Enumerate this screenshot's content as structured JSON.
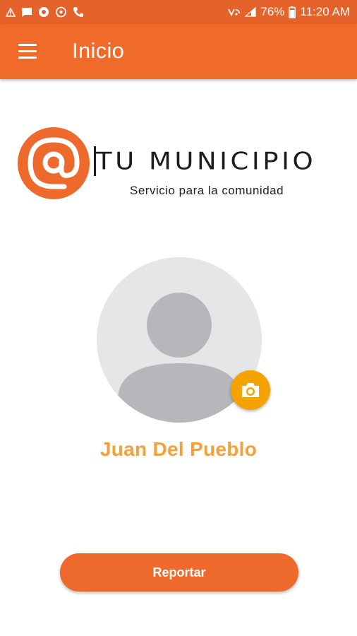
{
  "status_bar": {
    "left_icons": [
      "warning-icon",
      "message-icon",
      "chrome-icon",
      "whatsapp-icon",
      "call-icon"
    ],
    "battery": "76%",
    "time": "11:20 AM",
    "right_icons": [
      "volte-icon",
      "signal-icon",
      "battery-icon"
    ]
  },
  "app_bar": {
    "menu_icon": "menu-icon",
    "title": "Inicio"
  },
  "brand": {
    "name": "TU MUNICIPIO",
    "tagline": "Servicio para la comunidad",
    "logo_icon": "at-sign-icon"
  },
  "profile": {
    "avatar_icon": "avatar-placeholder-icon",
    "camera_icon": "camera-icon",
    "name": "Juan Del Pueblo"
  },
  "actions": {
    "report_label": "Reportar"
  },
  "colors": {
    "status_bar": "#e5632a",
    "app_bar": "#f06a2a",
    "accent_orange": "#f5a300",
    "name_text": "#f4a03c",
    "button": "#ee6a2c"
  }
}
